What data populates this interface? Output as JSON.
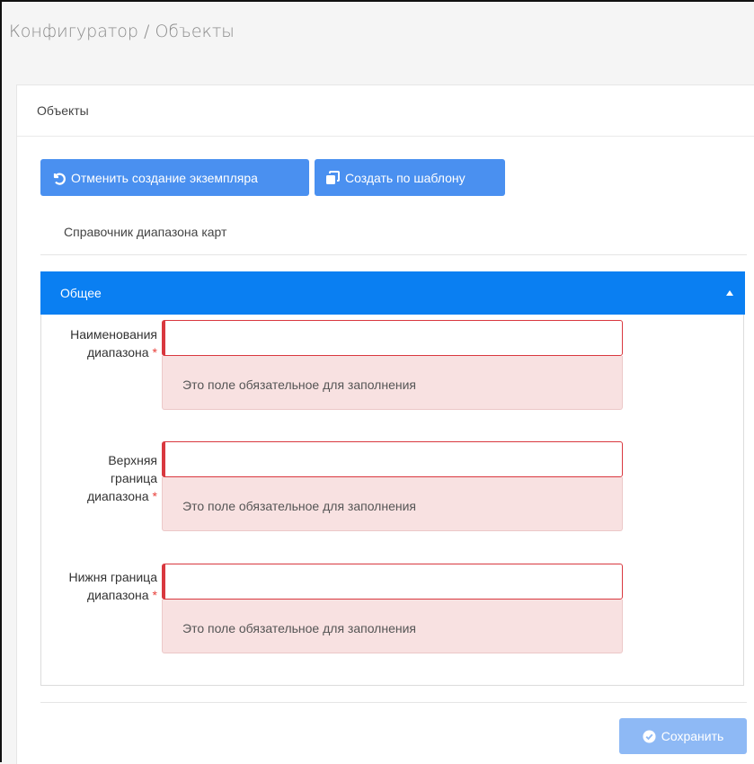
{
  "breadcrumb": "Конфигуратор / Объекты",
  "card": {
    "title": "Объекты"
  },
  "toolbar": {
    "cancel_label": "Отменить создание экземпляра",
    "template_label": "Создать по шаблону"
  },
  "subtitle": "Справочник диапазона карт",
  "section": {
    "title": "Общее",
    "collapse_icon": "triangle-up-icon"
  },
  "fields": [
    {
      "label_lines": [
        "Наименования",
        "диапазона"
      ],
      "value": "",
      "error": "Это поле обязательное для заполнения"
    },
    {
      "label_lines": [
        "Верхняя",
        "граница",
        "диапазона"
      ],
      "value": "",
      "error": "Это поле обязательное для заполнения"
    },
    {
      "label_lines": [
        "Нижня граница",
        "диапазона"
      ],
      "value": "",
      "error": "Это поле обязательное для заполнения"
    }
  ],
  "required_mark": "*",
  "save_label": "Сохранить",
  "colors": {
    "primary": "#0a7ff2",
    "button": "#4a90f0",
    "error": "#d9383f",
    "error_bg": "#f8e1e1",
    "disabled": "#8eb9f5"
  }
}
